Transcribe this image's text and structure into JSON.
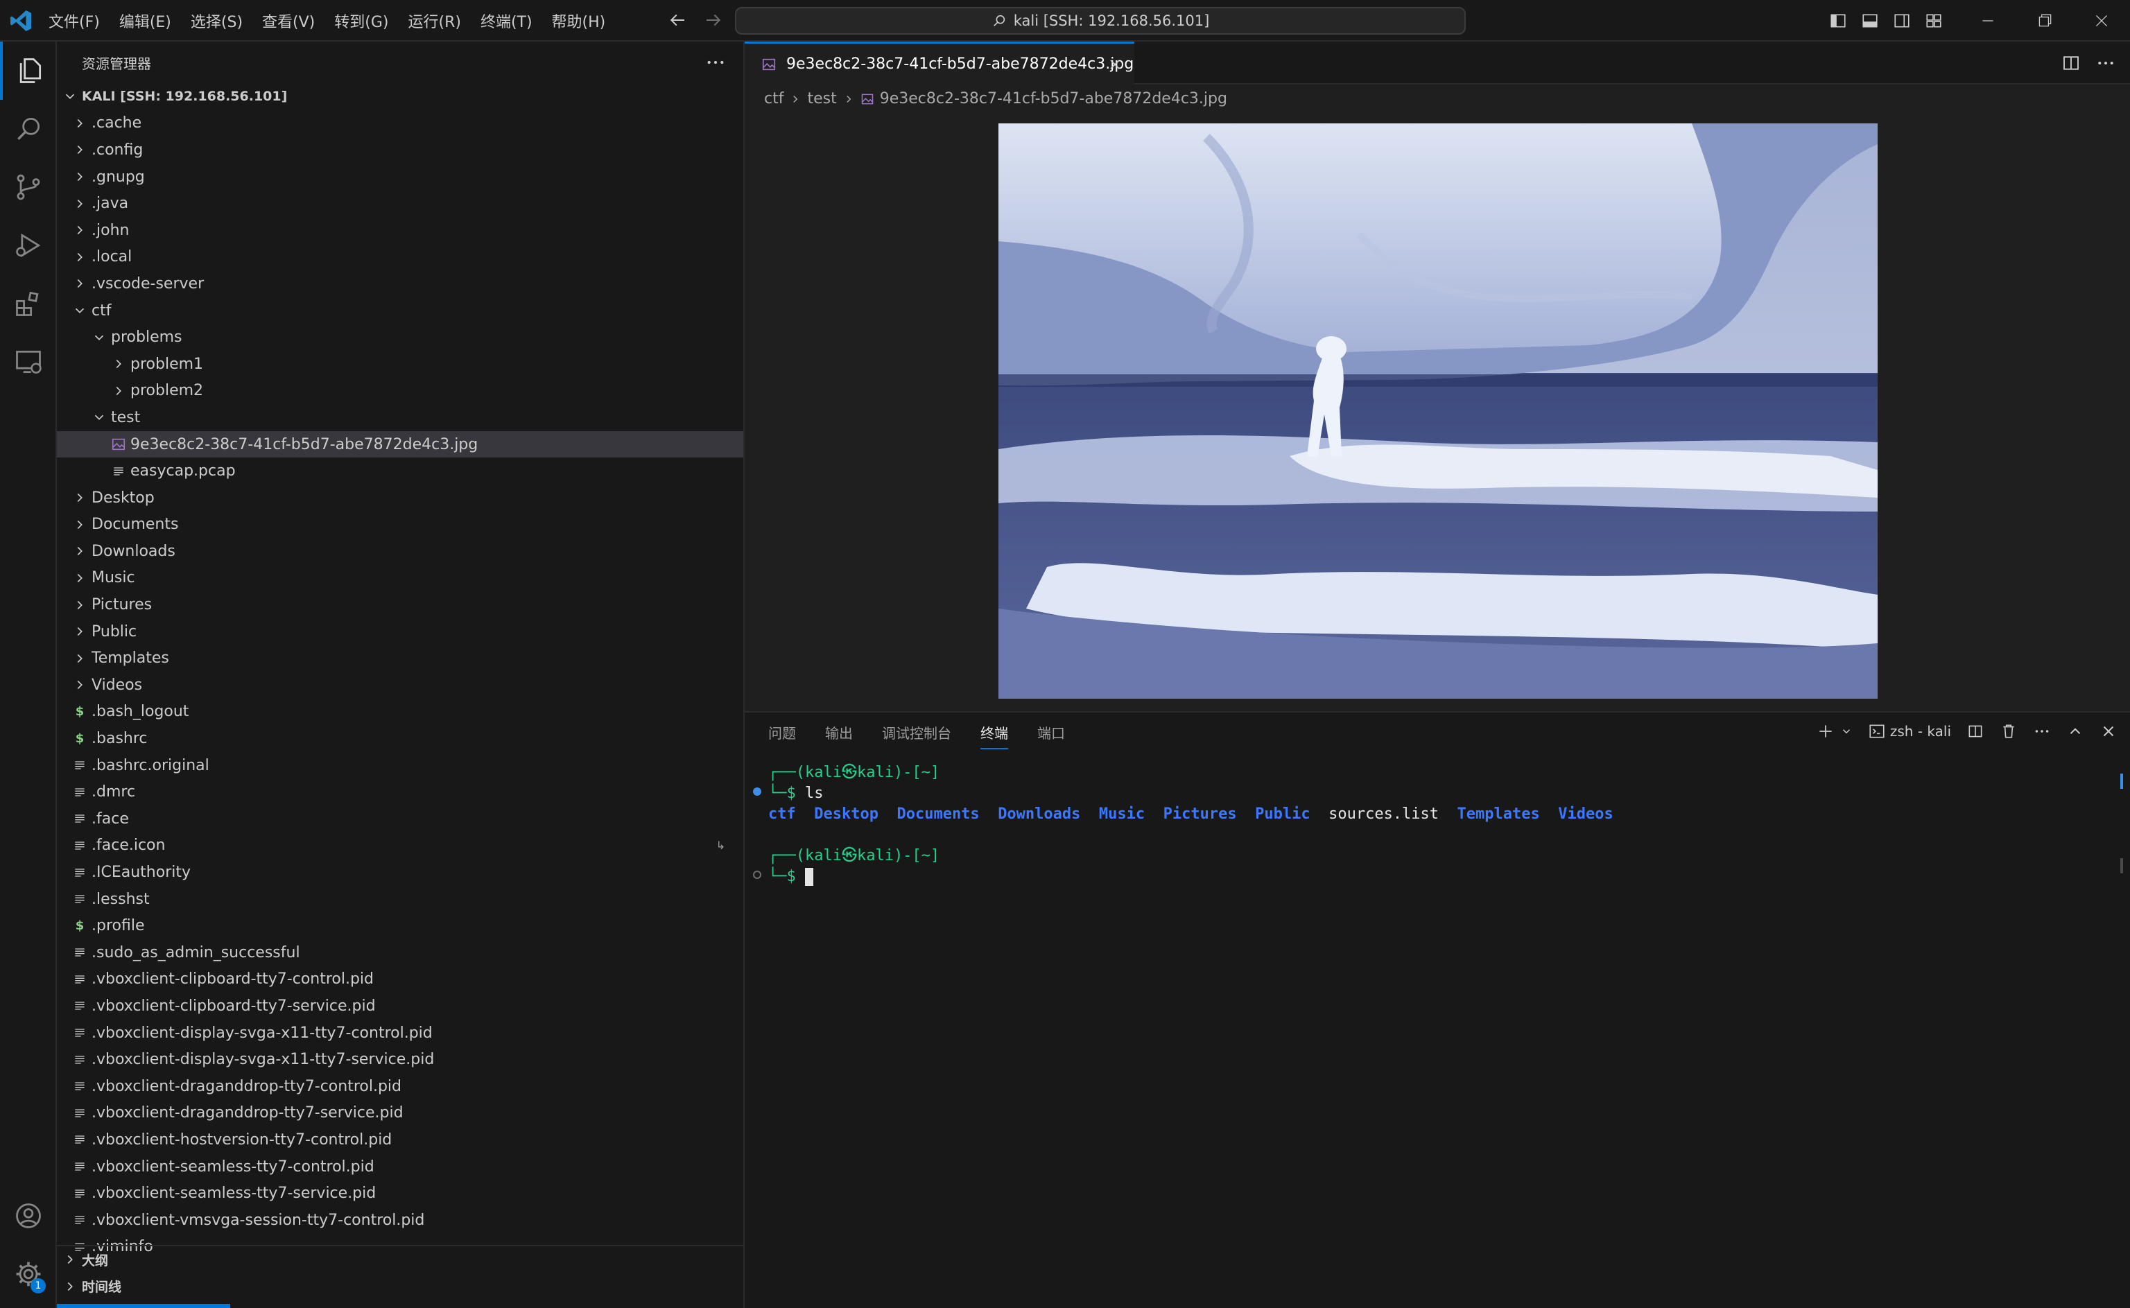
{
  "titlebar": {
    "menu": [
      "文件(F)",
      "编辑(E)",
      "选择(S)",
      "查看(V)",
      "转到(G)",
      "运行(R)",
      "终端(T)",
      "帮助(H)"
    ],
    "command_center": "kali [SSH: 192.168.56.101]"
  },
  "sidebar": {
    "title": "资源管理器",
    "root": "KALI [SSH: 192.168.56.101]",
    "items": [
      {
        "label": ".cache",
        "depth": 1,
        "kind": "folder",
        "open": false
      },
      {
        "label": ".config",
        "depth": 1,
        "kind": "folder",
        "open": false
      },
      {
        "label": ".gnupg",
        "depth": 1,
        "kind": "folder",
        "open": false
      },
      {
        "label": ".java",
        "depth": 1,
        "kind": "folder",
        "open": false
      },
      {
        "label": ".john",
        "depth": 1,
        "kind": "folder",
        "open": false
      },
      {
        "label": ".local",
        "depth": 1,
        "kind": "folder",
        "open": false
      },
      {
        "label": ".vscode-server",
        "depth": 1,
        "kind": "folder",
        "open": false
      },
      {
        "label": "ctf",
        "depth": 1,
        "kind": "folder",
        "open": true
      },
      {
        "label": "problems",
        "depth": 2,
        "kind": "folder",
        "open": true
      },
      {
        "label": "problem1",
        "depth": 3,
        "kind": "folder",
        "open": false
      },
      {
        "label": "problem2",
        "depth": 3,
        "kind": "folder",
        "open": false
      },
      {
        "label": "test",
        "depth": 2,
        "kind": "folder",
        "open": true
      },
      {
        "label": "9e3ec8c2-38c7-41cf-b5d7-abe7872de4c3.jpg",
        "depth": 3,
        "kind": "image",
        "selected": true
      },
      {
        "label": "easycap.pcap",
        "depth": 3,
        "kind": "file"
      },
      {
        "label": "Desktop",
        "depth": 1,
        "kind": "folder",
        "open": false
      },
      {
        "label": "Documents",
        "depth": 1,
        "kind": "folder",
        "open": false
      },
      {
        "label": "Downloads",
        "depth": 1,
        "kind": "folder",
        "open": false
      },
      {
        "label": "Music",
        "depth": 1,
        "kind": "folder",
        "open": false
      },
      {
        "label": "Pictures",
        "depth": 1,
        "kind": "folder",
        "open": false
      },
      {
        "label": "Public",
        "depth": 1,
        "kind": "folder",
        "open": false
      },
      {
        "label": "Templates",
        "depth": 1,
        "kind": "folder",
        "open": false
      },
      {
        "label": "Videos",
        "depth": 1,
        "kind": "folder",
        "open": false
      },
      {
        "label": ".bash_logout",
        "depth": 1,
        "kind": "shell"
      },
      {
        "label": ".bashrc",
        "depth": 1,
        "kind": "shell"
      },
      {
        "label": ".bashrc.original",
        "depth": 1,
        "kind": "file"
      },
      {
        "label": ".dmrc",
        "depth": 1,
        "kind": "file"
      },
      {
        "label": ".face",
        "depth": 1,
        "kind": "file"
      },
      {
        "label": ".face.icon",
        "depth": 1,
        "kind": "file",
        "symlink": true
      },
      {
        "label": ".ICEauthority",
        "depth": 1,
        "kind": "file"
      },
      {
        "label": ".lesshst",
        "depth": 1,
        "kind": "file"
      },
      {
        "label": ".profile",
        "depth": 1,
        "kind": "shell"
      },
      {
        "label": ".sudo_as_admin_successful",
        "depth": 1,
        "kind": "file"
      },
      {
        "label": ".vboxclient-clipboard-tty7-control.pid",
        "depth": 1,
        "kind": "file"
      },
      {
        "label": ".vboxclient-clipboard-tty7-service.pid",
        "depth": 1,
        "kind": "file"
      },
      {
        "label": ".vboxclient-display-svga-x11-tty7-control.pid",
        "depth": 1,
        "kind": "file"
      },
      {
        "label": ".vboxclient-display-svga-x11-tty7-service.pid",
        "depth": 1,
        "kind": "file"
      },
      {
        "label": ".vboxclient-draganddrop-tty7-control.pid",
        "depth": 1,
        "kind": "file"
      },
      {
        "label": ".vboxclient-draganddrop-tty7-service.pid",
        "depth": 1,
        "kind": "file"
      },
      {
        "label": ".vboxclient-hostversion-tty7-control.pid",
        "depth": 1,
        "kind": "file"
      },
      {
        "label": ".vboxclient-seamless-tty7-control.pid",
        "depth": 1,
        "kind": "file"
      },
      {
        "label": ".vboxclient-seamless-tty7-service.pid",
        "depth": 1,
        "kind": "file"
      },
      {
        "label": ".vboxclient-vmsvga-session-tty7-control.pid",
        "depth": 1,
        "kind": "file"
      },
      {
        "label": ".viminfo",
        "depth": 1,
        "kind": "file"
      }
    ],
    "outline": "大纲",
    "timeline": "时间线",
    "settings_badge": "1"
  },
  "editor": {
    "tab_label": "9e3ec8c2-38c7-41cf-b5d7-abe7872de4c3.jpg",
    "breadcrumb": [
      "ctf",
      "test",
      "9e3ec8c2-38c7-41cf-b5d7-abe7872de4c3.jpg"
    ]
  },
  "panel": {
    "tabs": [
      "问题",
      "输出",
      "调试控制台",
      "终端",
      "端口"
    ],
    "active_tab": "终端",
    "terminal_name": "zsh - kali",
    "prompt_top": "┌──(kali㉿kali)-[~]",
    "prompt_bottom": "└─$ ",
    "command": "ls",
    "ls_output": [
      {
        "name": "ctf",
        "type": "dir"
      },
      {
        "name": "Desktop",
        "type": "dir"
      },
      {
        "name": "Documents",
        "type": "dir"
      },
      {
        "name": "Downloads",
        "type": "dir"
      },
      {
        "name": "Music",
        "type": "dir"
      },
      {
        "name": "Pictures",
        "type": "dir"
      },
      {
        "name": "Public",
        "type": "dir"
      },
      {
        "name": "sources.list",
        "type": "file"
      },
      {
        "name": "Templates",
        "type": "dir"
      },
      {
        "name": "Videos",
        "type": "dir"
      }
    ]
  },
  "colors": {
    "accent": "#0078d4",
    "terminal_green": "#23d18b",
    "terminal_blue": "#3b8eea",
    "shell_icon": "#89d185",
    "image_icon": "#a074c4"
  }
}
